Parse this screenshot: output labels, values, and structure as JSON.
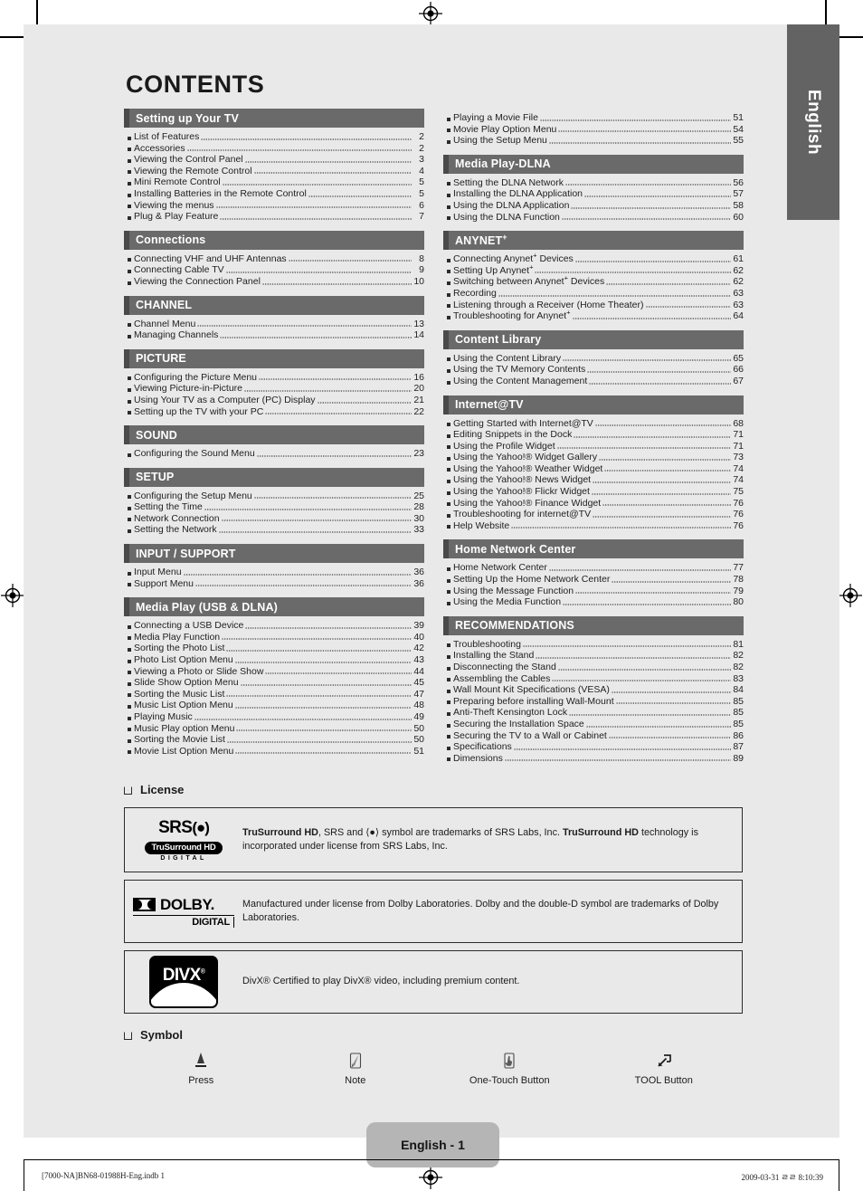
{
  "document": {
    "title": "CONTENTS",
    "language_tab": "English",
    "page_badge": "English - 1"
  },
  "toc": {
    "left_column": [
      {
        "heading": "Setting up Your TV",
        "items": [
          {
            "label": "List of Features",
            "page": "2"
          },
          {
            "label": "Accessories",
            "page": "2"
          },
          {
            "label": "Viewing the Control Panel",
            "page": "3"
          },
          {
            "label": "Viewing the Remote Control",
            "page": "4"
          },
          {
            "label": "Mini Remote Control",
            "page": "5"
          },
          {
            "label": "Installing Batteries in the Remote Control",
            "page": "5"
          },
          {
            "label": "Viewing the menus",
            "page": "6"
          },
          {
            "label": "Plug & Play Feature",
            "page": "7"
          }
        ]
      },
      {
        "heading": "Connections",
        "items": [
          {
            "label": "Connecting VHF and UHF Antennas",
            "page": "8"
          },
          {
            "label": "Connecting Cable TV",
            "page": "9"
          },
          {
            "label": "Viewing the Connection Panel",
            "page": "10"
          }
        ]
      },
      {
        "heading": "CHANNEL",
        "items": [
          {
            "label": "Channel Menu",
            "page": "13"
          },
          {
            "label": "Managing Channels",
            "page": "14"
          }
        ]
      },
      {
        "heading": "PICTURE",
        "items": [
          {
            "label": "Configuring the Picture Menu",
            "page": "16"
          },
          {
            "label": "Viewing Picture-in-Picture",
            "page": "20"
          },
          {
            "label": "Using Your TV as a Computer (PC) Display",
            "page": "21"
          },
          {
            "label": "Setting up the TV with your PC",
            "page": "22"
          }
        ]
      },
      {
        "heading": "SOUND",
        "items": [
          {
            "label": "Configuring the Sound Menu",
            "page": "23"
          }
        ]
      },
      {
        "heading": "SETUP",
        "items": [
          {
            "label": "Configuring the Setup Menu",
            "page": "25"
          },
          {
            "label": "Setting the Time",
            "page": "28"
          },
          {
            "label": "Network Connection",
            "page": "30"
          },
          {
            "label": "Setting the Network",
            "page": "33"
          }
        ]
      },
      {
        "heading": "INPUT / SUPPORT",
        "items": [
          {
            "label": "Input Menu",
            "page": "36"
          },
          {
            "label": "Support Menu",
            "page": "36"
          }
        ]
      },
      {
        "heading": "Media Play (USB & DLNA)",
        "items": [
          {
            "label": "Connecting a USB Device",
            "page": "39"
          },
          {
            "label": "Media Play Function",
            "page": "40"
          },
          {
            "label": "Sorting the Photo List",
            "page": "42"
          },
          {
            "label": "Photo List Option Menu",
            "page": "43"
          },
          {
            "label": "Viewing a Photo or Slide Show",
            "page": "44"
          },
          {
            "label": "Slide Show Option Menu",
            "page": "45"
          },
          {
            "label": "Sorting the Music List",
            "page": "47"
          },
          {
            "label": "Music List Option Menu",
            "page": "48"
          },
          {
            "label": "Playing Music",
            "page": "49"
          },
          {
            "label": "Music Play option Menu",
            "page": "50"
          },
          {
            "label": "Sorting the Movie List",
            "page": "50"
          },
          {
            "label": "Movie List Option Menu",
            "page": "51"
          }
        ]
      }
    ],
    "right_column": [
      {
        "heading": "",
        "items": [
          {
            "label": "Playing a Movie File",
            "page": "51"
          },
          {
            "label": "Movie Play Option Menu",
            "page": "54"
          },
          {
            "label": "Using the Setup Menu",
            "page": "55"
          }
        ]
      },
      {
        "heading": "Media Play-DLNA",
        "items": [
          {
            "label": "Setting the DLNA Network",
            "page": "56"
          },
          {
            "label": "Installing the DLNA Application",
            "page": "57"
          },
          {
            "label": "Using the DLNA Application",
            "page": "58"
          },
          {
            "label": "Using the DLNA Function",
            "page": "60"
          }
        ]
      },
      {
        "heading": "ANYNET",
        "heading_sup": "+",
        "items": [
          {
            "label": "Connecting Anynet",
            "sup": "+",
            "label2": " Devices",
            "page": "61"
          },
          {
            "label": "Setting Up Anynet",
            "sup": "+",
            "label2": "",
            "page": "62"
          },
          {
            "label": "Switching between Anynet",
            "sup": "+",
            "label2": " Devices",
            "page": "62"
          },
          {
            "label": "Recording",
            "page": "63"
          },
          {
            "label": "Listening through a Receiver (Home Theater)",
            "page": "63"
          },
          {
            "label": "Troubleshooting for Anynet",
            "sup": "+",
            "label2": "",
            "page": "64"
          }
        ]
      },
      {
        "heading": "Content Library",
        "items": [
          {
            "label": "Using the Content Library",
            "page": "65"
          },
          {
            "label": "Using the TV Memory Contents",
            "page": "66"
          },
          {
            "label": "Using the Content Management",
            "page": "67"
          }
        ]
      },
      {
        "heading": "Internet@TV",
        "items": [
          {
            "label": "Getting Started with Internet@TV",
            "page": "68"
          },
          {
            "label": "Editing Snippets in the Dock",
            "page": "71"
          },
          {
            "label": "Using the Profile Widget",
            "page": "71"
          },
          {
            "label": "Using the Yahoo!® Widget Gallery",
            "page": "73"
          },
          {
            "label": "Using the Yahoo!® Weather Widget",
            "page": "74"
          },
          {
            "label": "Using the Yahoo!® News Widget",
            "page": "74"
          },
          {
            "label": "Using the Yahoo!® Flickr Widget",
            "page": "75"
          },
          {
            "label": "Using the Yahoo!® Finance Widget",
            "page": "76"
          },
          {
            "label": "Troubleshooting for internet@TV",
            "page": "76"
          },
          {
            "label": "Help Website",
            "page": "76"
          }
        ]
      },
      {
        "heading": "Home Network Center",
        "items": [
          {
            "label": "Home Network Center",
            "page": "77"
          },
          {
            "label": "Setting Up the Home Network Center",
            "page": "78"
          },
          {
            "label": "Using the Message Function",
            "page": "79"
          },
          {
            "label": "Using the Media Function",
            "page": "80"
          }
        ]
      },
      {
        "heading": "RECOMMENDATIONS",
        "items": [
          {
            "label": "Troubleshooting",
            "page": "81"
          },
          {
            "label": "Installing the Stand",
            "page": "82"
          },
          {
            "label": "Disconnecting the Stand",
            "page": "82"
          },
          {
            "label": "Assembling the Cables",
            "page": "83"
          },
          {
            "label": "Wall Mount Kit Specifications (VESA)",
            "page": "84"
          },
          {
            "label": "Preparing before installing Wall-Mount",
            "page": "85"
          },
          {
            "label": "Anti-Theft Kensington Lock",
            "page": "85"
          },
          {
            "label": "Securing the Installation Space",
            "page": "85"
          },
          {
            "label": "Securing the TV to a Wall or Cabinet",
            "page": "86"
          },
          {
            "label": "Specifications",
            "page": "87"
          },
          {
            "label": "Dimensions",
            "page": "89"
          }
        ]
      }
    ]
  },
  "license": {
    "heading": "License",
    "srs": {
      "logo_word": "SRS",
      "logo_mark": "(●)",
      "logo_pill": "TruSurround HD",
      "logo_digital": "DIGITAL",
      "text_bold_1": "TruSurround HD",
      "text_mid": ", SRS and ⟨●⟩ symbol are trademarks of SRS Labs, Inc. ",
      "text_bold_2": "TruSurround HD",
      "text_end": " technology is incorporated under license from SRS Labs, Inc."
    },
    "dolby": {
      "logo_word": "DOLBY.",
      "logo_digital": "DIGITAL",
      "text": "Manufactured under license from Dolby Laboratories. Dolby and the double-D symbol are trademarks of Dolby Laboratories."
    },
    "divx": {
      "logo_word": "DIVX",
      "text": "DivX® Certified to play DivX® video, including premium content."
    }
  },
  "symbol": {
    "heading": "Symbol",
    "items": [
      {
        "icon": "press-triangle-icon",
        "label": "Press"
      },
      {
        "icon": "note-pencil-icon",
        "label": "Note"
      },
      {
        "icon": "one-touch-hand-icon",
        "label": "One-Touch Button"
      },
      {
        "icon": "tool-arrow-icon",
        "label": "TOOL Button"
      }
    ]
  },
  "print_footer": {
    "file": "[7000-NA]BN68-01988H-Eng.indb   1",
    "timestamp": "2009-03-31   ㄹㄹ 8:10:39"
  }
}
